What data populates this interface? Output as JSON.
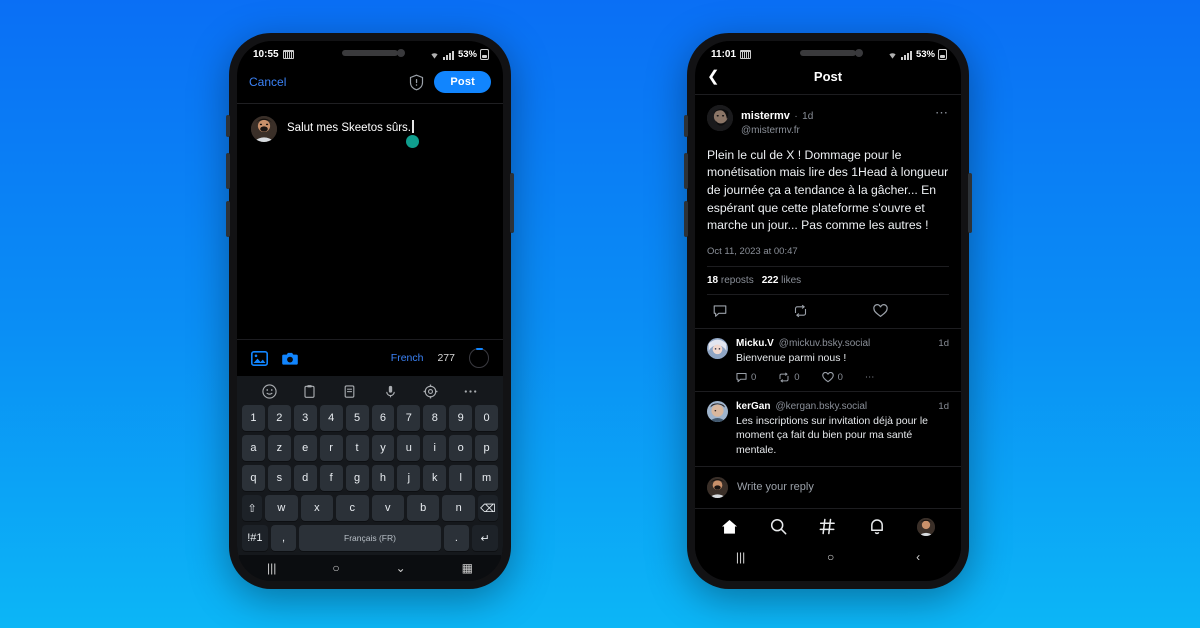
{
  "background": {
    "gradient_from": "#0a6ff5",
    "gradient_to": "#0cb6f6"
  },
  "accent": {
    "brand_blue": "#1185fe",
    "link_blue": "#3b82f6",
    "muted": "#8a8f98",
    "cursor_teal": "#0f9e8e"
  },
  "left_phone": {
    "status_bar": {
      "time": "10:55",
      "battery_percent": "53%",
      "sim_icon": "sim-icon",
      "wifi_icon": "wifi-icon",
      "signal_icon": "signal-bars-icon",
      "battery_icon": "battery-icon"
    },
    "composer": {
      "cancel_label": "Cancel",
      "shield_icon": "shield-warning-icon",
      "post_label": "Post",
      "avatar_icon": "user-avatar",
      "text_value": "Salut mes Skeetos sûrs.",
      "cursor_handle_icon": "text-cursor-handle"
    },
    "toolbar": {
      "image_icon": "image-picker-icon",
      "camera_icon": "camera-icon",
      "language_label": "French",
      "char_count": "277",
      "progress_ring_icon": "character-count-ring"
    },
    "keyboard": {
      "tool_icons": [
        "emoji-icon",
        "clipboard-icon",
        "sticker-icon",
        "microphone-icon",
        "settings-gear-icon",
        "more-options-icon"
      ],
      "row_numbers": [
        "1",
        "2",
        "3",
        "4",
        "5",
        "6",
        "7",
        "8",
        "9",
        "0"
      ],
      "row_top": [
        "a",
        "z",
        "e",
        "r",
        "t",
        "y",
        "u",
        "i",
        "o",
        "p"
      ],
      "row_home": [
        "q",
        "s",
        "d",
        "f",
        "g",
        "h",
        "j",
        "k",
        "l",
        "m"
      ],
      "row_bottom": [
        "w",
        "x",
        "c",
        "v",
        "b",
        "n"
      ],
      "shift_label": "⇧",
      "backspace_label": "⌫",
      "symbols_label": "!#1",
      "comma_label": ",",
      "space_label": "Français (FR)",
      "period_label": ".",
      "enter_label": "↵"
    },
    "system_nav": {
      "recents": "|||",
      "home": "○",
      "hide_keyboard": "⌄",
      "keyboard_switch": "▦"
    }
  },
  "right_phone": {
    "status_bar": {
      "time": "11:01",
      "battery_percent": "53%",
      "sim_icon": "sim-icon",
      "wifi_icon": "wifi-icon",
      "signal_icon": "signal-bars-icon",
      "battery_icon": "battery-icon"
    },
    "header": {
      "back_icon": "back-chevron-icon",
      "title": "Post"
    },
    "post": {
      "avatar_icon": "author-avatar",
      "display_name": "mistermv",
      "age_separator": "·",
      "age": "1d",
      "handle": "@mistermv.fr",
      "more_icon": "more-options-icon",
      "body": "Plein le cul de X ! Dommage pour le monétisation mais lire des 1Head à longueur de journée ça a tendance à la gâcher... En espérant que cette plateforme s'ouvre et marche un jour... Pas comme les autres !",
      "timestamp": "Oct 11, 2023 at 00:47",
      "reposts_count": "18",
      "reposts_label": "reposts",
      "likes_count": "222",
      "likes_label": "likes",
      "action_icons": [
        "reply-icon",
        "repost-icon",
        "like-icon"
      ]
    },
    "replies": [
      {
        "avatar_icon": "replier-avatar",
        "display_name": "Micku.V",
        "handle": "@mickuv.bsky.social",
        "age": "1d",
        "body": "Bienvenue parmi nous !",
        "reply_count": "0",
        "repost_count": "0",
        "like_count": "0",
        "more_icon": "more-options-icon"
      },
      {
        "avatar_icon": "replier-avatar",
        "display_name": "kerGan",
        "handle": "@kergan.bsky.social",
        "age": "1d",
        "body": "Les inscriptions sur invitation déjà pour le moment ça fait du bien pour ma santé mentale.",
        "reply_count": "",
        "repost_count": "",
        "like_count": "",
        "more_icon": ""
      }
    ],
    "reply_composer": {
      "avatar_icon": "user-avatar",
      "placeholder": "Write your reply"
    },
    "bottom_nav": {
      "items": [
        "home-icon",
        "search-icon",
        "hashtag-feeds-icon",
        "notifications-bell-icon",
        "profile-avatar-icon"
      ]
    },
    "system_nav": {
      "recents": "|||",
      "home": "○",
      "back": "‹"
    }
  }
}
